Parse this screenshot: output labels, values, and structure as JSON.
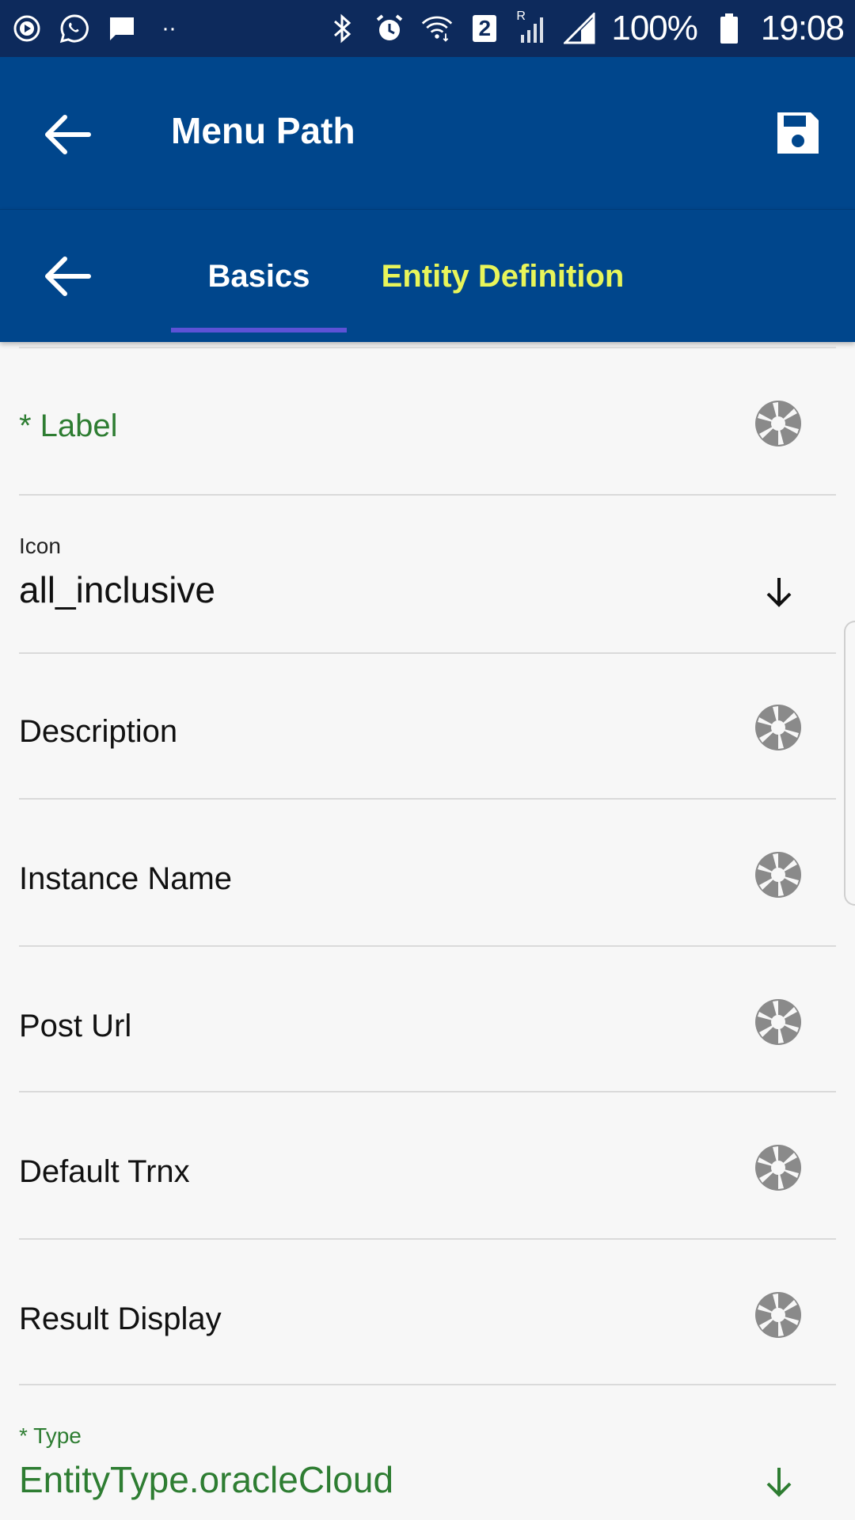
{
  "status_bar": {
    "battery": "100%",
    "time": "19:08",
    "sim_badge": "2",
    "roaming": "R",
    "dots": "··"
  },
  "app_bar": {
    "title": "Menu Path"
  },
  "tabs": [
    {
      "label": "Basics",
      "active": true
    },
    {
      "label": "Entity Definition",
      "active": false
    }
  ],
  "fields": {
    "label": {
      "label": "* Label"
    },
    "icon": {
      "caption": "Icon",
      "value": "all_inclusive"
    },
    "description": {
      "label": "Description"
    },
    "instance_name": {
      "label": "Instance Name"
    },
    "post_url": {
      "label": "Post Url"
    },
    "default_trnx": {
      "label": "Default Trnx"
    },
    "result_display": {
      "label": "Result Display"
    },
    "type": {
      "caption": "* Type",
      "value": "EntityType.oracleCloud"
    }
  },
  "colors": {
    "status_bar": "#0d2a5c",
    "app_bar": "#00468c",
    "active_tab_text": "#ffffff",
    "inactive_tab_text": "#e8f55a",
    "tab_indicator": "#5d52d6",
    "required_green": "#2e7d32",
    "icon_grey": "#8a8a8a"
  }
}
